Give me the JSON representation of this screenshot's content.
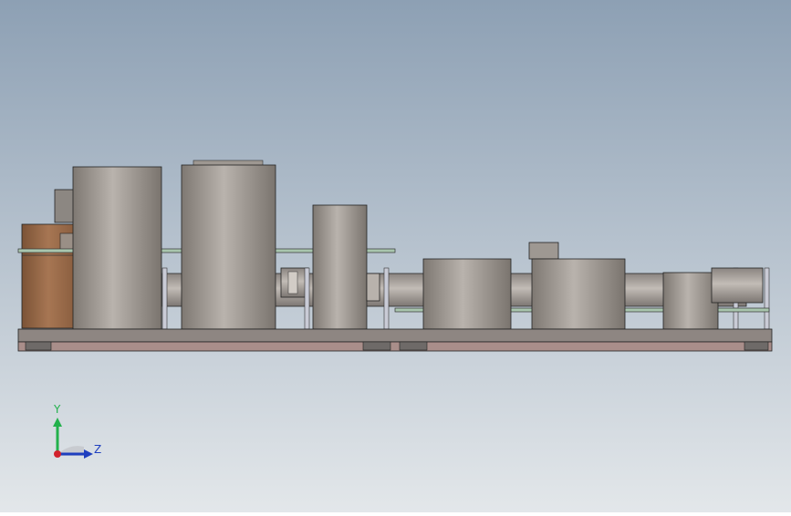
{
  "viewport": {
    "background_top": "#8da0b4",
    "background_bottom": "#e3e7ea"
  },
  "colors": {
    "cylinder_light": "#b3ada7",
    "cylinder_dark": "#7e7872",
    "base_plate": "#a98e8a",
    "base_plate_top": "#8e8682",
    "board_green": "#9fc0a4",
    "motor_brown": "#9a6b49",
    "outline": "#1b1b1b"
  },
  "triad": {
    "y_label": "Y",
    "z_label": "Z",
    "y_color": "#22b14c",
    "z_color": "#1f3fbf",
    "x_color": "#d2222d"
  }
}
